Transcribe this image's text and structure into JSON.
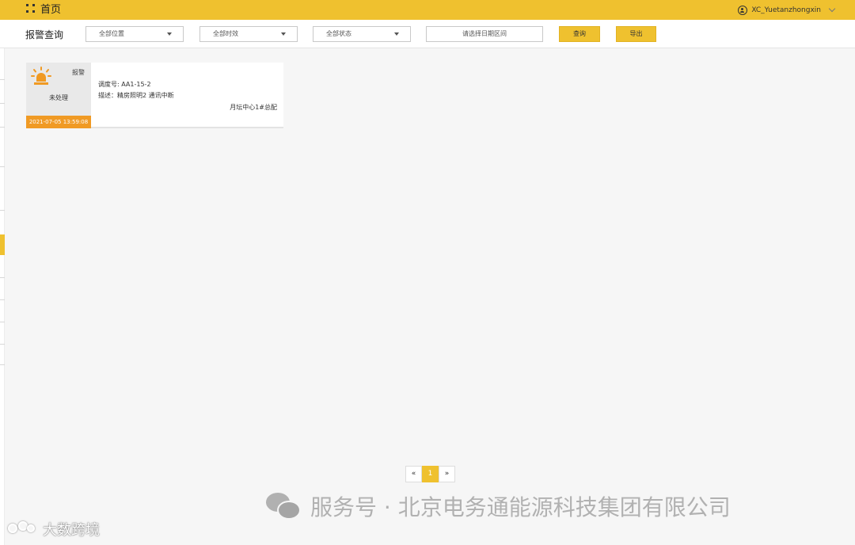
{
  "header": {
    "home_title": "首页",
    "user_name": "XC_Yuetanzhongxin",
    "accent_color": "#efc12f"
  },
  "filters": {
    "page_title": "报警查询",
    "location_select": "全部位置",
    "validity_select": "全部时效",
    "status_select": "全部状态",
    "date_range_placeholder": "请选择日期区间",
    "query_button": "查询",
    "export_button": "导出"
  },
  "alarm_cards": [
    {
      "tag": "报警",
      "status": "未处理",
      "time": "2021-07-05 13:59:08",
      "dispatch_line": "调度号: AA1-15-2",
      "description_line": "描述：精房照明2 通讯中断",
      "location": "月坛中心1#总配",
      "icon": "alarm-siren-icon",
      "time_bg_color": "#f09a24"
    }
  ],
  "pagination": {
    "prev": "«",
    "current": "1",
    "next": "»"
  },
  "watermark": {
    "main_text": "服务号 · 北京电务通能源科技集团有限公司",
    "corner_text": "大数跨境"
  }
}
